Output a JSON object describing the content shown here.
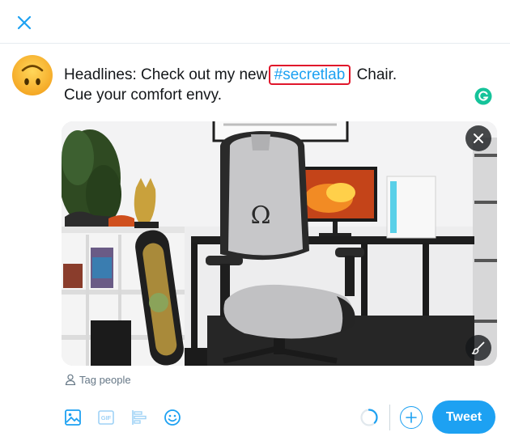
{
  "header": {
    "close_icon": "close-icon"
  },
  "compose": {
    "avatar_icon": "upside-down-face-emoji",
    "text_before": "Headlines: Check out my new ",
    "hashtag": "#secretlab",
    "text_after": " Chair.",
    "line2": "Cue your comfort envy.",
    "grammarly_icon": "grammarly-icon"
  },
  "media": {
    "remove_icon": "close-icon",
    "edit_icon": "brush-icon"
  },
  "tag_people": {
    "label": "Tag people",
    "icon": "person-icon"
  },
  "toolbar": {
    "tools": [
      "image-icon",
      "gif-icon",
      "poll-icon",
      "emoji-icon"
    ],
    "gif_label": "GIF",
    "tweet_label": "Tweet"
  },
  "colors": {
    "accent": "#1da1f2",
    "hashtag_highlight": "#e0162b",
    "muted": "#657786",
    "grammarly": "#15c39a"
  }
}
